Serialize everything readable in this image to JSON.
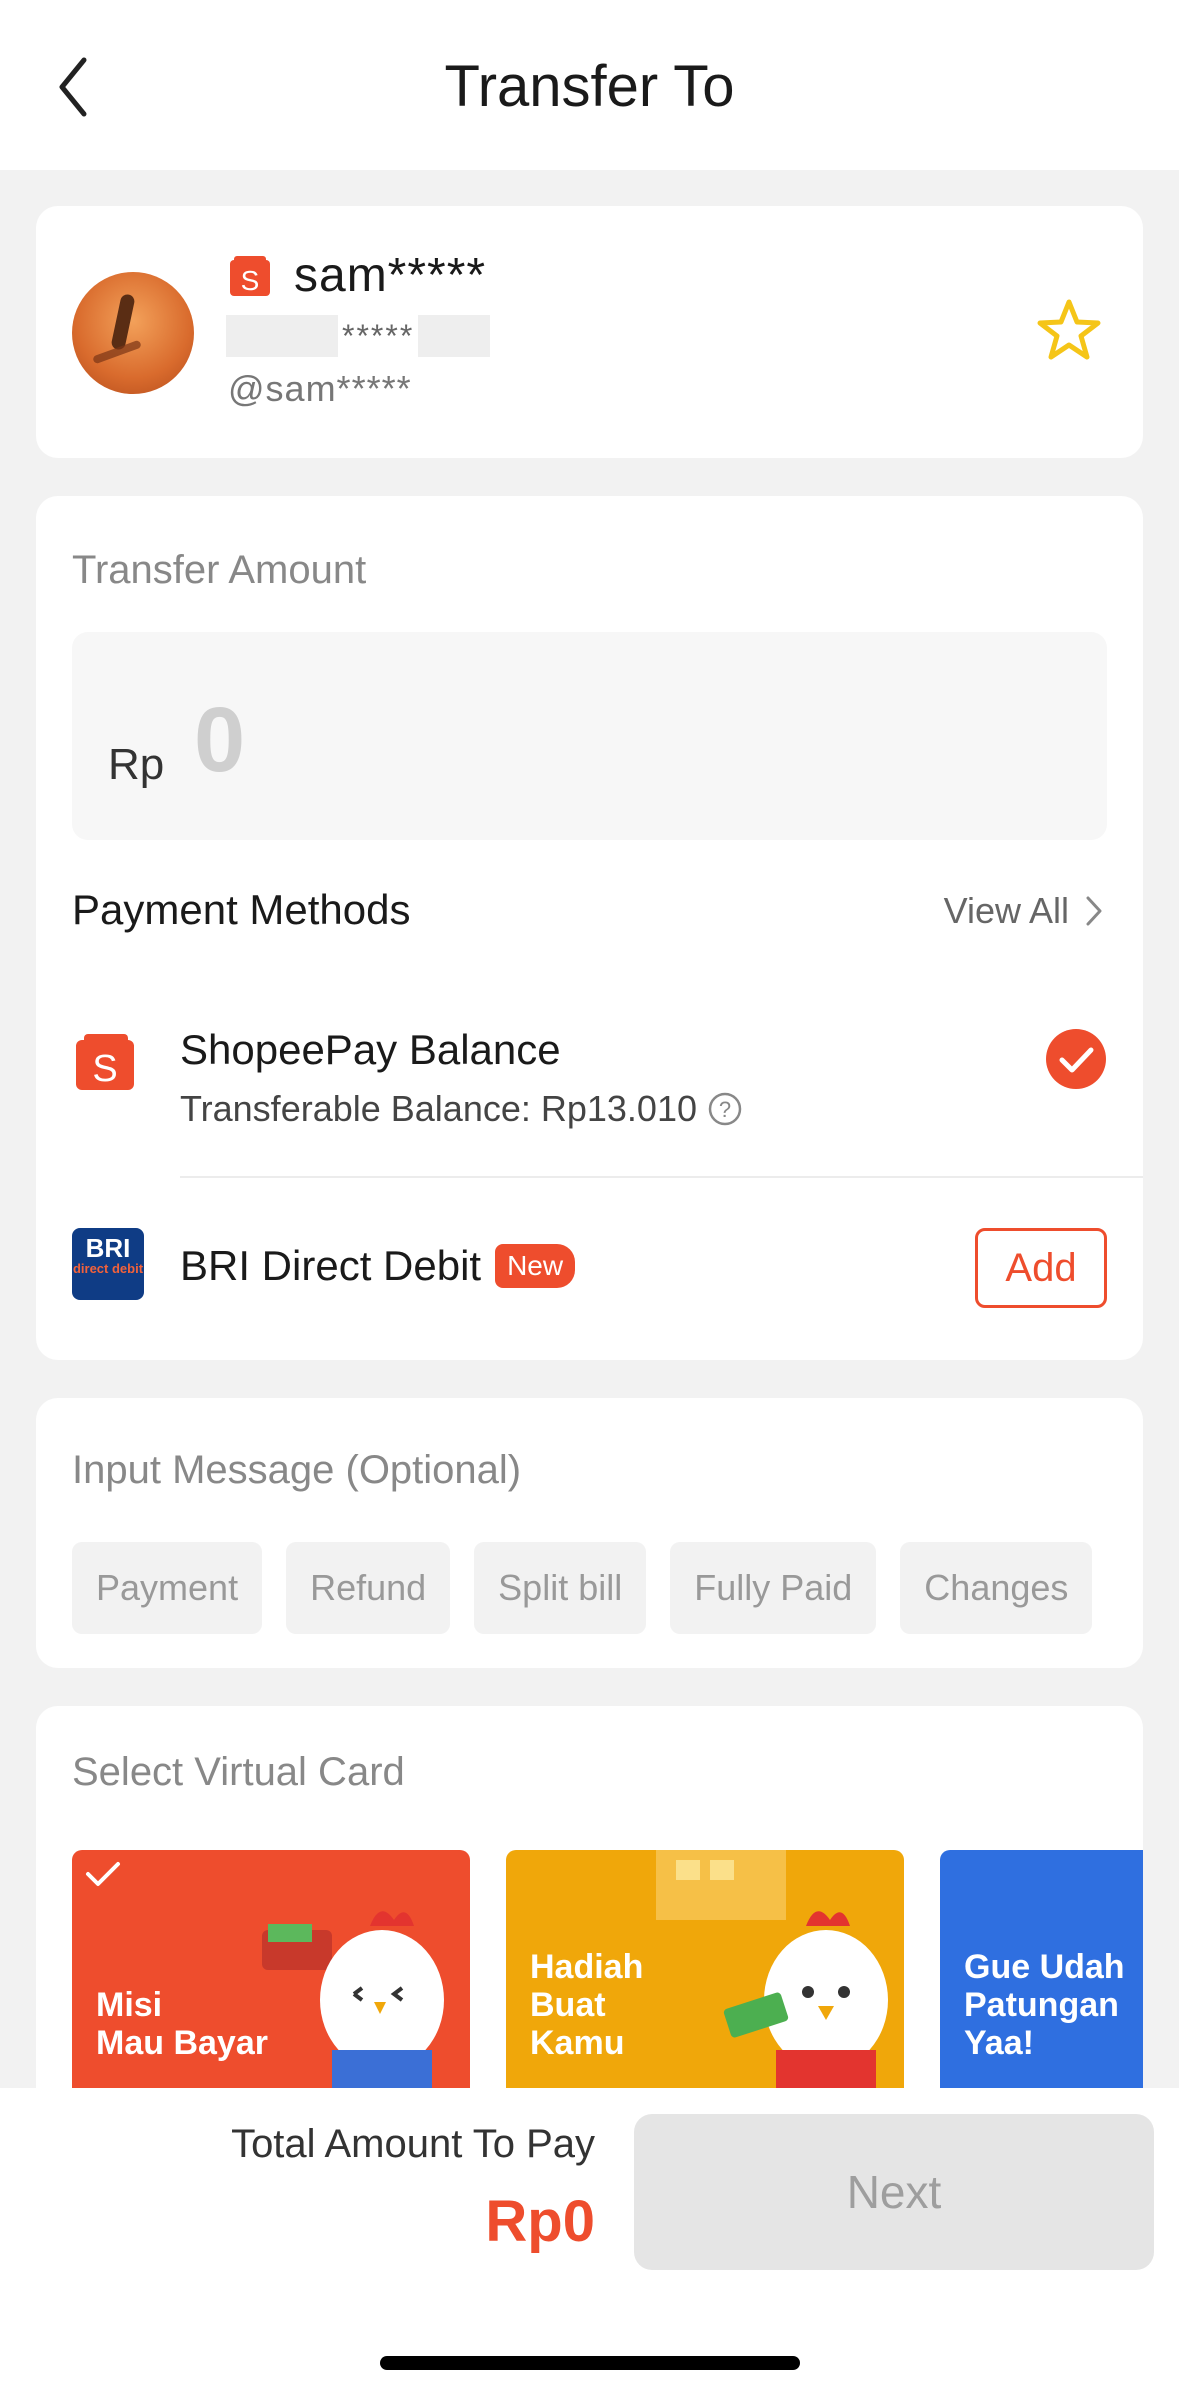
{
  "header": {
    "title": "Transfer To",
    "back_icon": "chevron-left-icon"
  },
  "recipient": {
    "name": "sam*****",
    "masked_phone": "*****",
    "username": "@sam*****",
    "badge_icon": "shopee-logo-icon",
    "favorite_icon": "star-outline-icon"
  },
  "transfer": {
    "label": "Transfer Amount",
    "currency": "Rp",
    "amount": "0"
  },
  "payment_methods": {
    "title": "Payment Methods",
    "view_all": "View All",
    "items": [
      {
        "name": "ShopeePay Balance",
        "detail": "Transferable Balance: Rp13.010",
        "selected": true,
        "icon": "shopeepay-icon"
      },
      {
        "name": "BRI Direct Debit",
        "badge": "New",
        "action": "Add",
        "icon": "bri-logo-icon",
        "logo_text": "BRI",
        "logo_sub": "direct debit"
      }
    ]
  },
  "message": {
    "label": "Input Message (Optional)",
    "chips": [
      "Payment",
      "Refund",
      "Split bill",
      "Fully Paid",
      "Changes"
    ]
  },
  "virtual_card": {
    "label": "Select Virtual Card",
    "cards": [
      {
        "text": "Misi\nMau Bayar",
        "color": "#ee4d2d",
        "selected": true
      },
      {
        "text": "Hadiah\nBuat\nKamu",
        "color": "#f0a70a",
        "selected": false
      },
      {
        "text": "Gue Udah\nPatungan\nYaa!",
        "color": "#2f6fe0",
        "selected": false
      }
    ]
  },
  "footer": {
    "total_label": "Total Amount To Pay",
    "total_value": "Rp0",
    "next_label": "Next"
  },
  "colors": {
    "accent": "#ee4d2d",
    "star": "#f5c518",
    "bri_blue": "#0f3c85"
  }
}
